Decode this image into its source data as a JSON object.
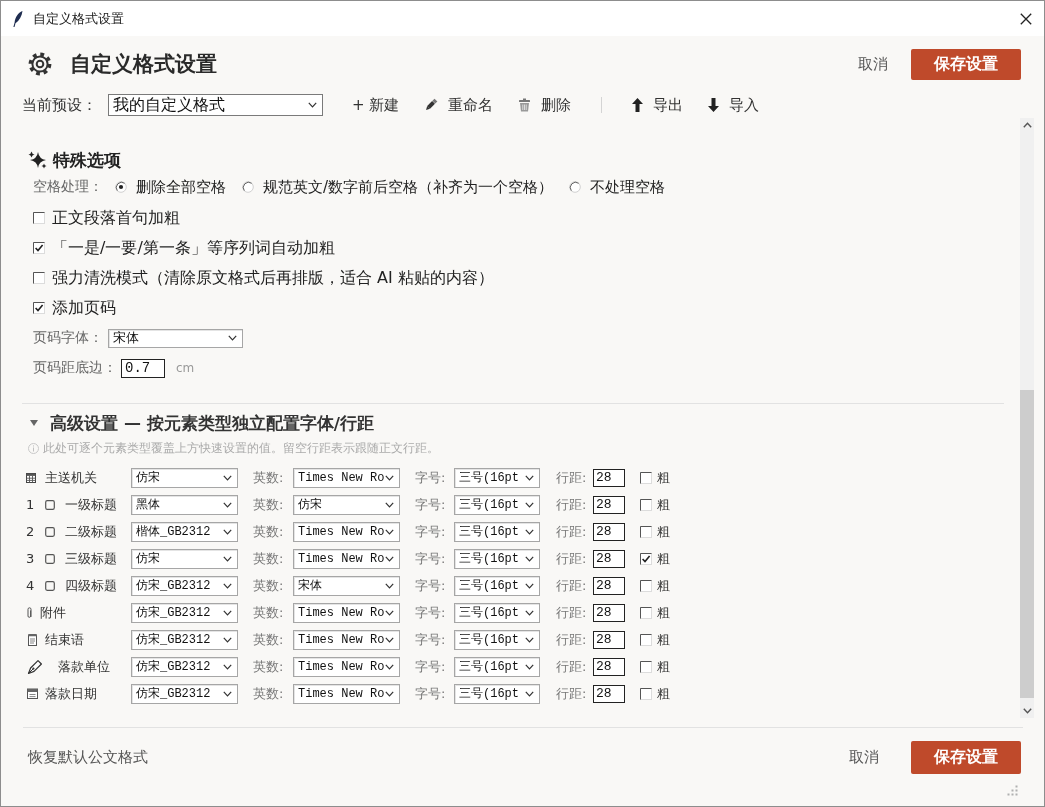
{
  "window": {
    "title": "自定义格式设置"
  },
  "header": {
    "title": "自定义格式设置",
    "cancel": "取消",
    "save": "保存设置"
  },
  "preset_bar": {
    "label": "当前预设：",
    "value": "我的自定义格式",
    "action_groups": [
      {
        "actions": [
          {
            "label": "+ 新建"
          },
          {
            "label": "重命名"
          },
          {
            "label": "删除"
          }
        ]
      },
      {
        "actions": [
          {
            "label": "导出"
          },
          {
            "label": "导入"
          }
        ]
      }
    ]
  },
  "special_options": {
    "title": "特殊选项",
    "space_handling": {
      "label": "空格处理：",
      "options": [
        {
          "label": "删除全部空格",
          "selected": true
        },
        {
          "label": "规范英文/数字前后空格（补齐为一个空格）",
          "selected": false
        },
        {
          "label": "不处理空格",
          "selected": false
        }
      ]
    },
    "checkboxes": [
      {
        "label": "正文段落首句加粗",
        "checked": false
      },
      {
        "label": "「一是/一要/第一条」等序列词自动加粗",
        "checked": true
      },
      {
        "label": "强力清洗模式（清除原文格式后再排版，适合 AI 粘贴的内容）",
        "checked": false
      },
      {
        "label": "添加页码",
        "checked": true
      }
    ],
    "page_number_font": {
      "label": "页码字体：",
      "value": "宋体"
    },
    "page_number_bottom": {
      "label": "页码距底边：",
      "value": "0.7",
      "unit": "cm"
    }
  },
  "advanced": {
    "title": "高级设置 — 按元素类型独立配置字体/行距",
    "expanded": true,
    "hint": "此处可逐个元素类型覆盖上方快速设置的值。留空行距表示跟随正文行距。",
    "rows": [
      {
        "kind": "icon",
        "label": "主送机关",
        "font": "仿宋",
        "latin_label": "英数:",
        "latin_font": "Times New Ro",
        "size_label": "字号:",
        "size": "三号(16pt",
        "spacing_label": "行距:",
        "spacing": "28",
        "bold_label": "粗",
        "bold": false
      },
      {
        "kind": "numbered",
        "number": "1",
        "label": "一级标题",
        "font": "黑体",
        "latin_label": "英数:",
        "latin_font": "仿宋",
        "size_label": "字号:",
        "size": "三号(16pt",
        "spacing_label": "行距:",
        "spacing": "28",
        "bold_label": "粗",
        "bold": false
      },
      {
        "kind": "numbered",
        "number": "2",
        "label": "二级标题",
        "font": "楷体_GB2312",
        "latin_label": "英数:",
        "latin_font": "Times New Ro",
        "size_label": "字号:",
        "size": "三号(16pt",
        "spacing_label": "行距:",
        "spacing": "28",
        "bold_label": "粗",
        "bold": false
      },
      {
        "kind": "numbered",
        "number": "3",
        "label": "三级标题",
        "font": "仿宋",
        "latin_label": "英数:",
        "latin_font": "Times New Ro",
        "size_label": "字号:",
        "size": "三号(16pt",
        "spacing_label": "行距:",
        "spacing": "28",
        "bold_label": "粗",
        "bold": true
      },
      {
        "kind": "numbered",
        "number": "4",
        "label": "四级标题",
        "font": "仿宋_GB2312",
        "latin_label": "英数:",
        "latin_font": "宋体",
        "size_label": "字号:",
        "size": "三号(16pt",
        "spacing_label": "行距:",
        "spacing": "28",
        "bold_label": "粗",
        "bold": false
      },
      {
        "kind": "icon",
        "label": "附件",
        "font": "仿宋_GB2312",
        "latin_label": "英数:",
        "latin_font": "Times New Ro",
        "size_label": "字号:",
        "size": "三号(16pt",
        "spacing_label": "行距:",
        "spacing": "28",
        "bold_label": "粗",
        "bold": false
      },
      {
        "kind": "icon",
        "label": "结束语",
        "font": "仿宋_GB2312",
        "latin_label": "英数:",
        "latin_font": "Times New Ro",
        "size_label": "字号:",
        "size": "三号(16pt",
        "spacing_label": "行距:",
        "spacing": "28",
        "bold_label": "粗",
        "bold": false
      },
      {
        "kind": "icon",
        "label": "落款单位",
        "font": "仿宋_GB2312",
        "latin_label": "英数:",
        "latin_font": "Times New Ro",
        "size_label": "字号:",
        "size": "三号(16pt",
        "spacing_label": "行距:",
        "spacing": "28",
        "bold_label": "粗",
        "bold": false
      },
      {
        "kind": "icon",
        "label": "落款日期",
        "font": "仿宋_GB2312",
        "latin_label": "英数:",
        "latin_font": "Times New Ro",
        "size_label": "字号:",
        "size": "三号(16pt",
        "spacing_label": "行距:",
        "spacing": "28",
        "bold_label": "粗",
        "bold": false
      }
    ]
  },
  "footer": {
    "reset": "恢复默认公文格式",
    "cancel": "取消",
    "save": "保存设置"
  }
}
